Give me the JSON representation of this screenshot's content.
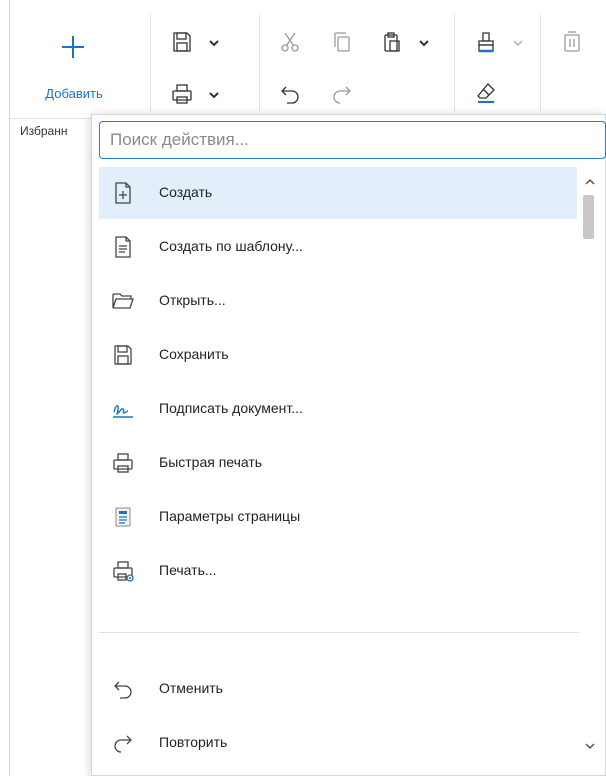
{
  "ribbon": {
    "add_label": "Добавить",
    "favorites_label": "Избранн"
  },
  "search": {
    "placeholder": "Поиск действия..."
  },
  "menu": {
    "items": [
      {
        "label": "Создать",
        "icon": "new-document-icon",
        "selected": true
      },
      {
        "label": "Создать по шаблону...",
        "icon": "template-document-icon"
      },
      {
        "label": "Открыть...",
        "icon": "folder-open-icon"
      },
      {
        "label": "Сохранить",
        "icon": "save-icon"
      },
      {
        "label": "Подписать документ...",
        "icon": "signature-icon"
      },
      {
        "label": "Быстрая печать",
        "icon": "printer-icon"
      },
      {
        "label": "Параметры страницы",
        "icon": "page-settings-icon"
      },
      {
        "label": "Печать...",
        "icon": "print-settings-icon"
      },
      {
        "label": "Отменить",
        "icon": "undo-icon"
      },
      {
        "label": "Повторить",
        "icon": "redo-icon"
      }
    ]
  },
  "colors": {
    "accent": "#1a73c8",
    "selection": "#e2effa",
    "search_border": "#2a7dd1"
  }
}
